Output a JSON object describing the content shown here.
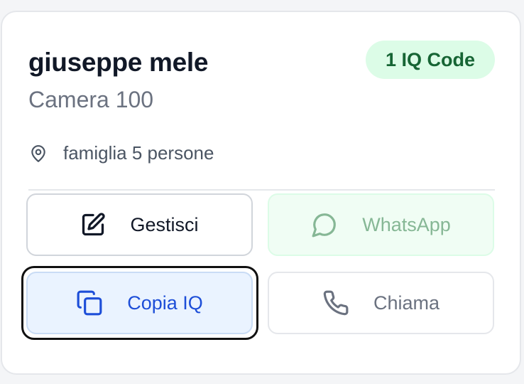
{
  "guest": {
    "name": "giuseppe mele",
    "room": "Camera 100",
    "badge": "1 IQ Code",
    "location": "famiglia 5 persone"
  },
  "actions": {
    "gestisci": "Gestisci",
    "whatsapp": "WhatsApp",
    "copia": "Copia IQ",
    "chiama": "Chiama"
  },
  "icons": {
    "location": "map-pin-icon",
    "gestisci": "edit-icon",
    "whatsapp": "message-circle-icon",
    "copia": "copy-icon",
    "chiama": "phone-icon"
  },
  "colors": {
    "badge_bg": "#dcfce7",
    "badge_text": "#166534",
    "whatsapp_text": "#86b795",
    "copia_text": "#1d4ed8",
    "copia_bg": "#eaf3ff"
  }
}
